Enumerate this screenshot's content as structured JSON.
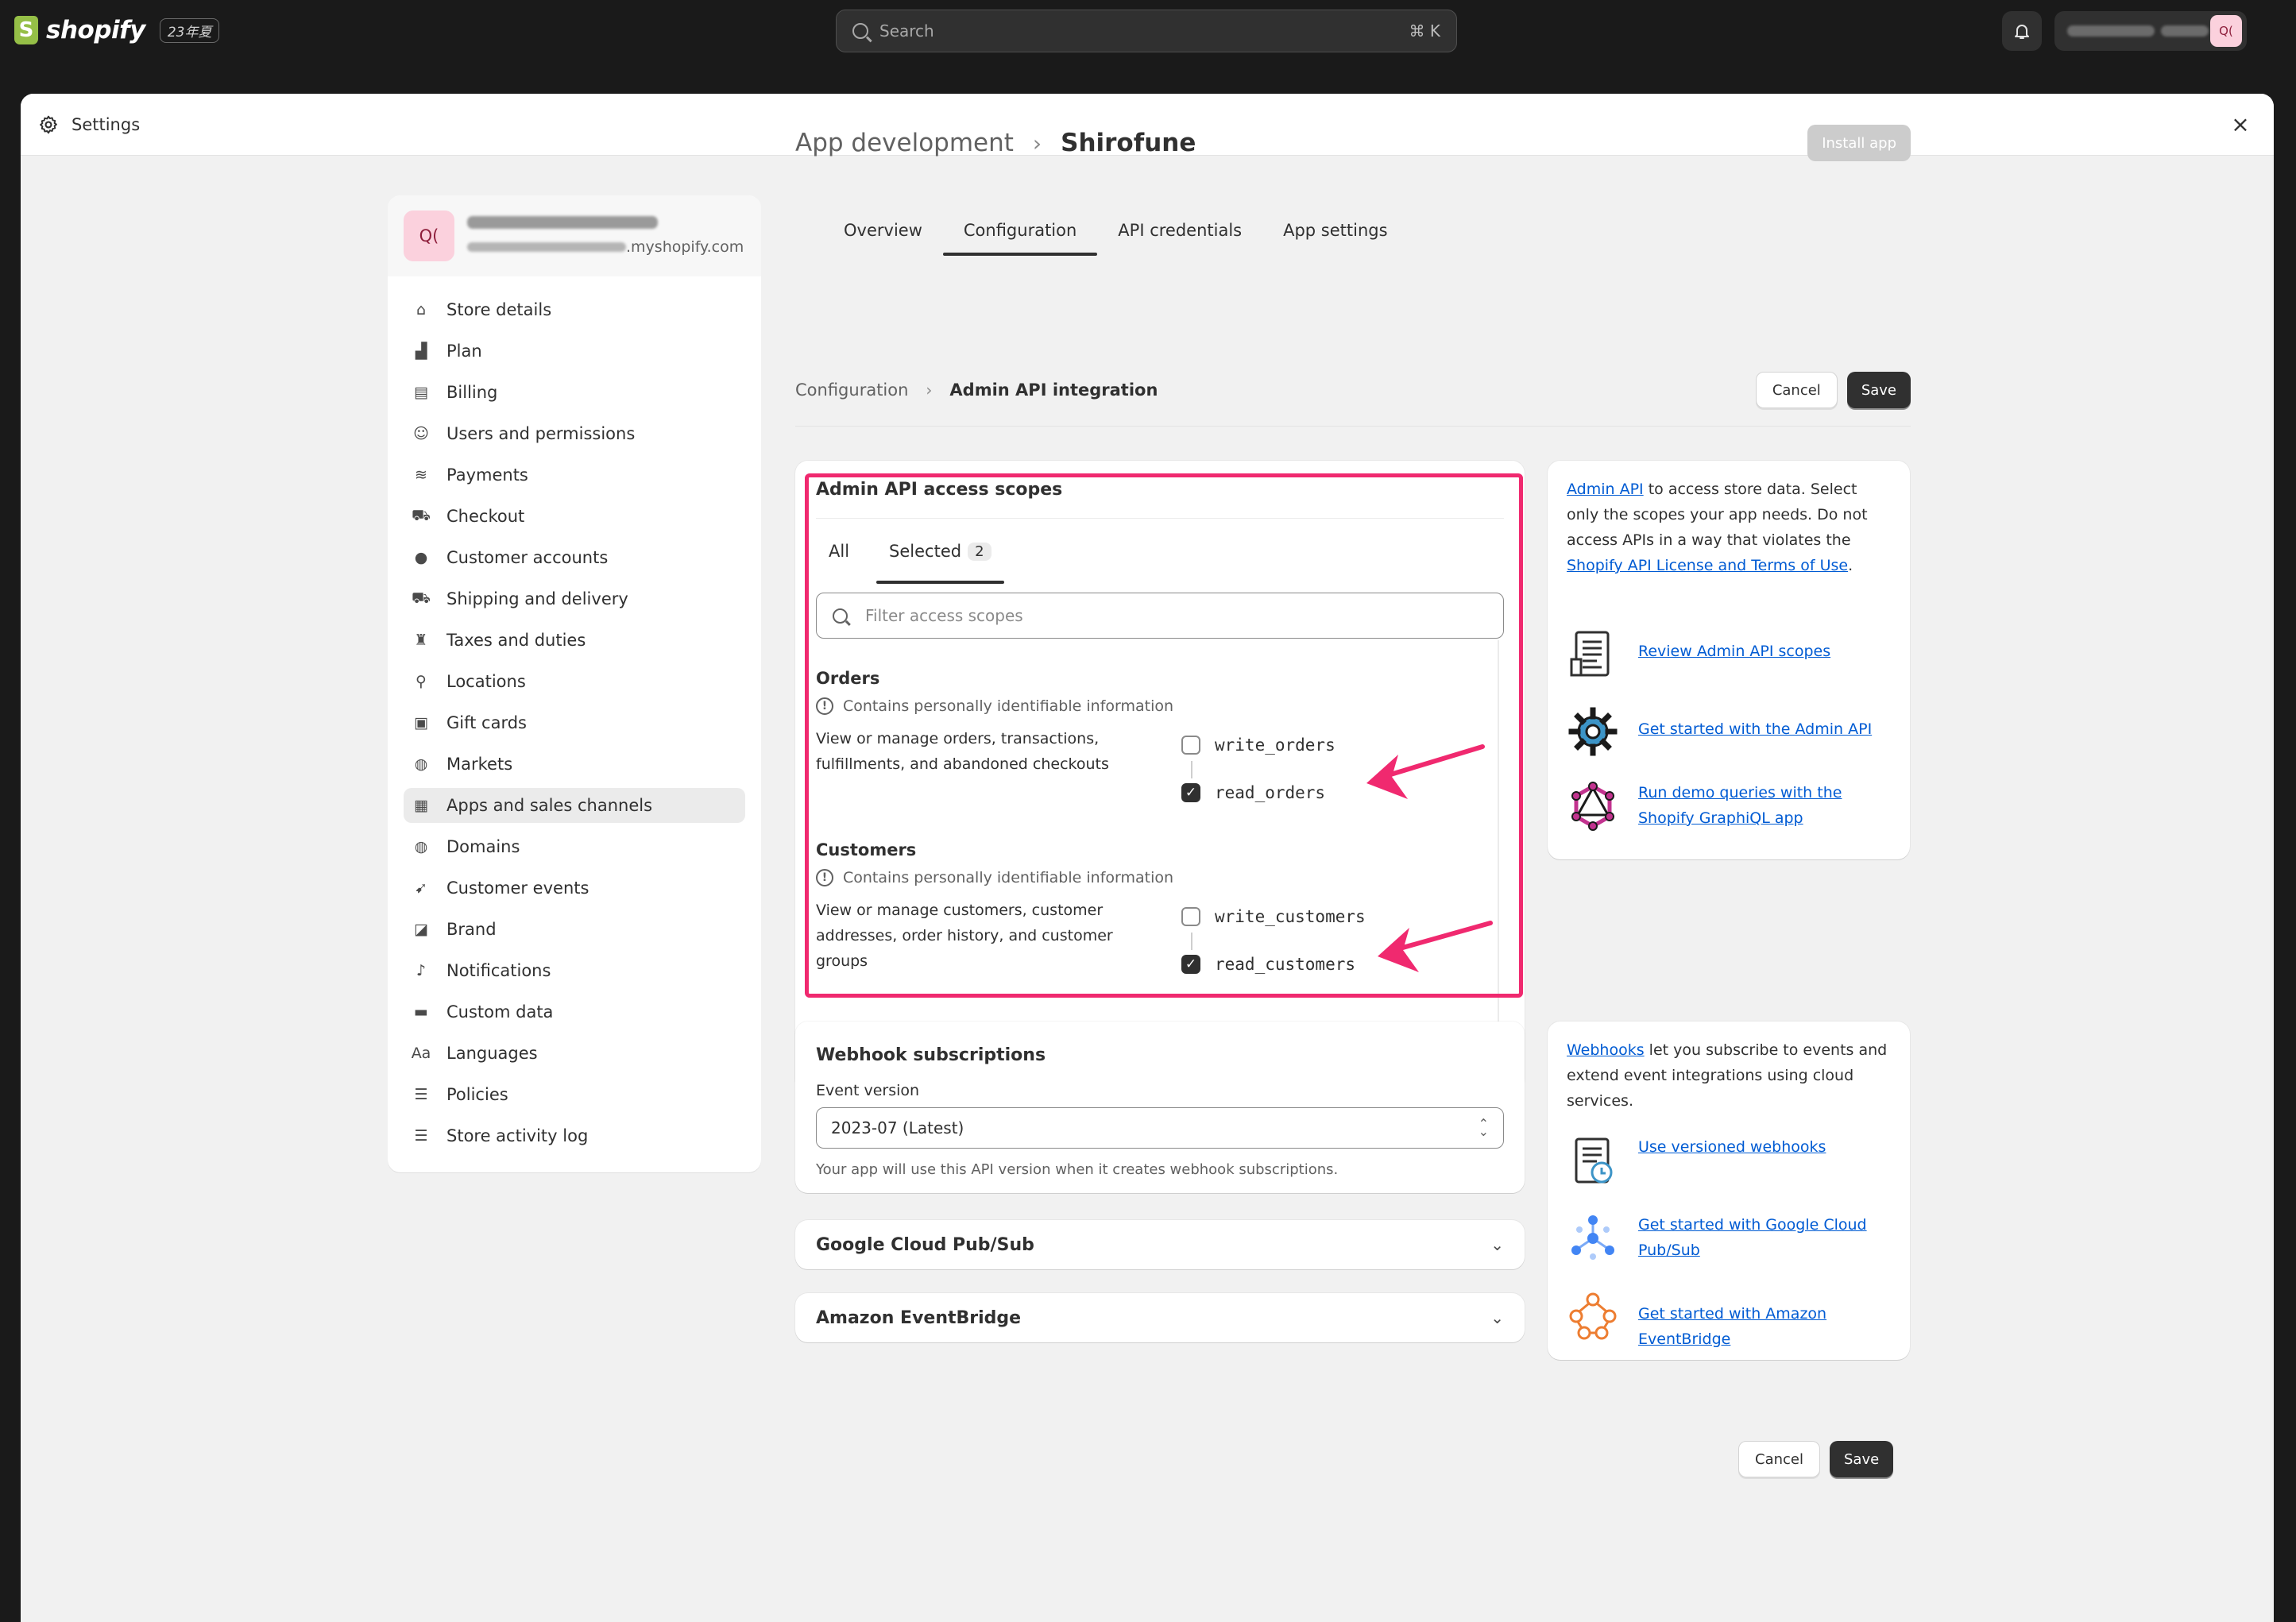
{
  "topbar": {
    "brand": "shopify",
    "edition": "23年夏",
    "search_placeholder": "Search",
    "search_shortcut": "⌘ K"
  },
  "modal": {
    "title": "Settings",
    "close": "×"
  },
  "store": {
    "avatar": "Q(",
    "domain_suffix": ".myshopify.com"
  },
  "sidebar": {
    "items": [
      {
        "label": "Store details",
        "icon": "store-icon"
      },
      {
        "label": "Plan",
        "icon": "plan-icon"
      },
      {
        "label": "Billing",
        "icon": "billing-icon"
      },
      {
        "label": "Users and permissions",
        "icon": "users-icon"
      },
      {
        "label": "Payments",
        "icon": "payments-icon"
      },
      {
        "label": "Checkout",
        "icon": "cart-icon"
      },
      {
        "label": "Customer accounts",
        "icon": "person-icon"
      },
      {
        "label": "Shipping and delivery",
        "icon": "truck-icon"
      },
      {
        "label": "Taxes and duties",
        "icon": "tax-icon"
      },
      {
        "label": "Locations",
        "icon": "location-icon"
      },
      {
        "label": "Gift cards",
        "icon": "giftcard-icon"
      },
      {
        "label": "Markets",
        "icon": "globe-icon"
      },
      {
        "label": "Apps and sales channels",
        "icon": "apps-icon"
      },
      {
        "label": "Domains",
        "icon": "globe-icon"
      },
      {
        "label": "Customer events",
        "icon": "cursor-icon"
      },
      {
        "label": "Brand",
        "icon": "brand-icon"
      },
      {
        "label": "Notifications",
        "icon": "bell-icon"
      },
      {
        "label": "Custom data",
        "icon": "data-icon"
      },
      {
        "label": "Languages",
        "icon": "language-icon"
      },
      {
        "label": "Policies",
        "icon": "policy-icon"
      },
      {
        "label": "Store activity log",
        "icon": "list-icon"
      }
    ],
    "active_index": 12
  },
  "page": {
    "breadcrumb_parent": "App development",
    "app_name": "Shirofune",
    "install_button": "Install app",
    "tabs": [
      "Overview",
      "Configuration",
      "API credentials",
      "App settings"
    ],
    "active_tab": 1,
    "sub_breadcrumb_parent": "Configuration",
    "sub_breadcrumb_current": "Admin API integration",
    "cancel": "Cancel",
    "save": "Save"
  },
  "scopes": {
    "title": "Admin API access scopes",
    "tab_all": "All",
    "tab_selected": "Selected",
    "selected_count": "2",
    "filter_placeholder": "Filter access scopes",
    "groups": [
      {
        "title": "Orders",
        "pii": "Contains personally identifiable information",
        "description": "View or manage orders, transactions, fulfillments, and abandoned checkouts",
        "write": "write_orders",
        "read": "read_orders",
        "write_checked": false,
        "read_checked": true
      },
      {
        "title": "Customers",
        "pii": "Contains personally identifiable information",
        "description": "View or manage customers, customer addresses, order history, and customer groups",
        "write": "write_customers",
        "read": "read_customers",
        "write_checked": false,
        "read_checked": true
      }
    ]
  },
  "api_info": {
    "link1": "Admin API",
    "text1": "to access store data. Select only the scopes your app needs. Do not access APIs in a way that violates the",
    "link2": "Shopify API License and Terms of Use",
    "text2": ".",
    "resources": [
      {
        "label": "Review Admin API scopes",
        "icon": "document-icon"
      },
      {
        "label": "Get started with the Admin API",
        "icon": "gear-icon"
      },
      {
        "label": "Run demo queries with the Shopify GraphiQL app",
        "icon": "graphql-icon"
      }
    ]
  },
  "webhook": {
    "title": "Webhook subscriptions",
    "event_version_label": "Event version",
    "event_version_value": "2023-07 (Latest)",
    "help": "Your app will use this API version when it creates webhook subscriptions."
  },
  "webhook_info": {
    "link1": "Webhooks",
    "text1": "let you subscribe to events and extend event integrations using cloud services.",
    "resources": [
      {
        "label": "Use versioned webhooks",
        "icon": "document-clock-icon"
      },
      {
        "label": "Get started with Google Cloud Pub/Sub",
        "icon": "pubsub-icon"
      },
      {
        "label": "Get started with Amazon EventBridge",
        "icon": "eventbridge-icon"
      }
    ]
  },
  "collapsibles": [
    {
      "label": "Google Cloud Pub/Sub"
    },
    {
      "label": "Amazon EventBridge"
    }
  ],
  "colors": {
    "highlight": "#f0296f",
    "link": "#005bd3",
    "primary_button": "#303030"
  }
}
